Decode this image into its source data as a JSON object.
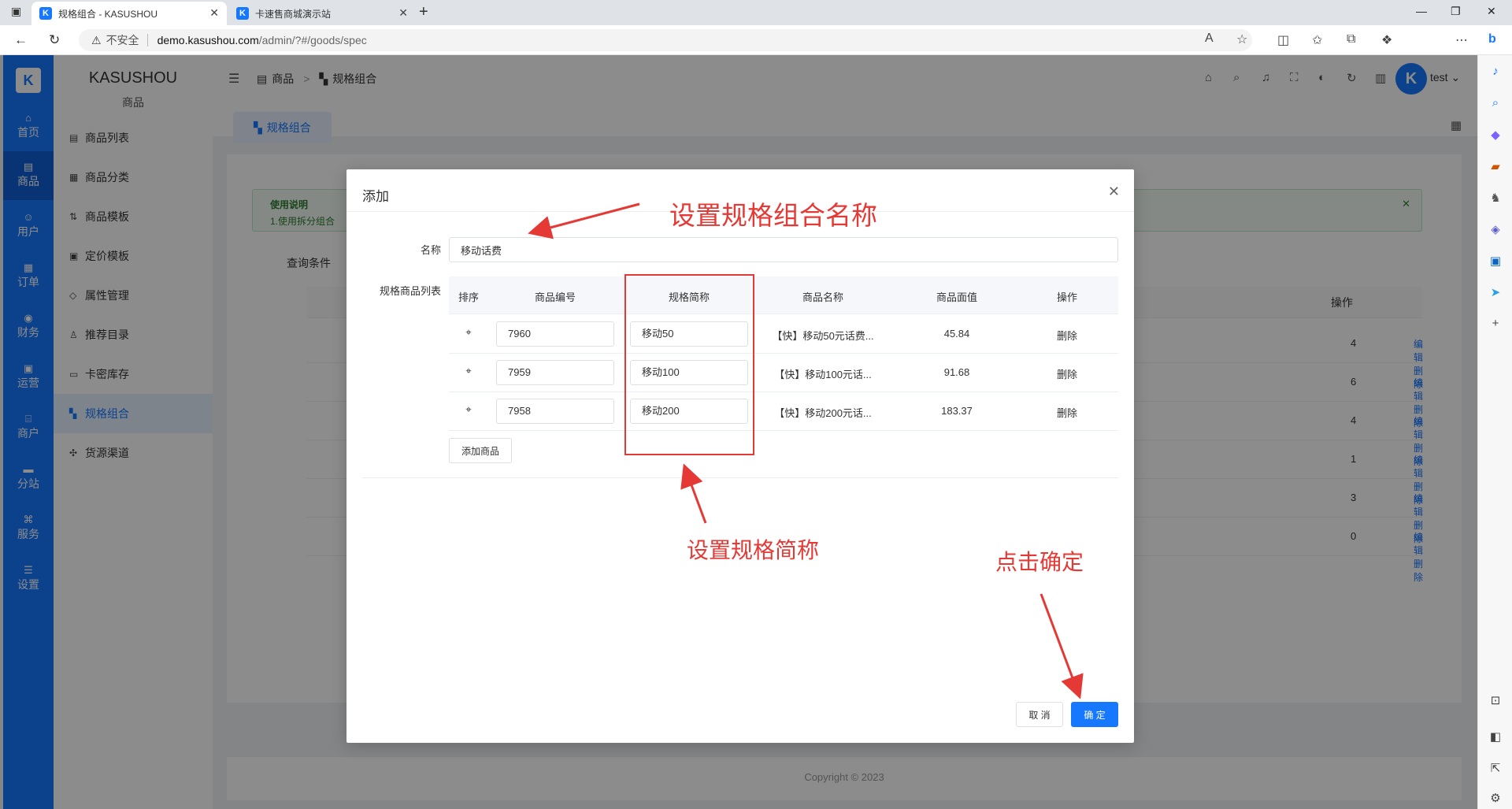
{
  "browser": {
    "tabs": [
      {
        "title": "规格组合 - KASUSHOU",
        "favicon": "K"
      },
      {
        "title": "卡速售商城演示站",
        "favicon": "K"
      }
    ],
    "address": {
      "warning_label": "不安全",
      "host": "demo.kasushou.com",
      "path": "/admin/?#/goods/spec"
    }
  },
  "rail": {
    "logo": "K",
    "items": [
      {
        "icon": "home-icon",
        "label": "首页"
      },
      {
        "icon": "goods-icon",
        "label": "商品"
      },
      {
        "icon": "user-icon",
        "label": "用户"
      },
      {
        "icon": "order-icon",
        "label": "订单"
      },
      {
        "icon": "finance-icon",
        "label": "财务"
      },
      {
        "icon": "operate-icon",
        "label": "运营"
      },
      {
        "icon": "merchant-icon",
        "label": "商户"
      },
      {
        "icon": "branch-icon",
        "label": "分站"
      },
      {
        "icon": "service-icon",
        "label": "服务"
      },
      {
        "icon": "settings-icon",
        "label": "设置"
      }
    ],
    "active_index": 1
  },
  "submenu": {
    "brand": "KASUSHOU",
    "section": "商品",
    "items": [
      {
        "icon": "list-icon",
        "label": "商品列表"
      },
      {
        "icon": "category-icon",
        "label": "商品分类"
      },
      {
        "icon": "template-icon",
        "label": "商品模板"
      },
      {
        "icon": "price-icon",
        "label": "定价模板"
      },
      {
        "icon": "tag-icon",
        "label": "属性管理"
      },
      {
        "icon": "thumb-icon",
        "label": "推荐目录"
      },
      {
        "icon": "card-icon",
        "label": "卡密库存"
      },
      {
        "icon": "spec-icon",
        "label": "规格组合"
      },
      {
        "icon": "source-icon",
        "label": "货源渠道"
      }
    ],
    "active_index": 7
  },
  "header": {
    "breadcrumb": [
      "商品",
      "规格组合"
    ],
    "breadcrumb_sep": ">",
    "user": "test",
    "avatar": "K"
  },
  "page_tab": "规格组合",
  "background": {
    "notice_title": "使用说明",
    "notice_text": "1.使用拆分组合",
    "query_label": "查询条件",
    "op_header": "操作",
    "rows": [
      {
        "num": "4",
        "edit": "编辑",
        "del": "删除"
      },
      {
        "num": "6",
        "edit": "编辑",
        "del": "删除"
      },
      {
        "num": "4",
        "edit": "编辑",
        "del": "删除"
      },
      {
        "num": "1",
        "edit": "编辑",
        "del": "删除"
      },
      {
        "num": "3",
        "edit": "编辑",
        "del": "删除"
      },
      {
        "num": "0",
        "edit": "编辑",
        "del": "删除"
      }
    ],
    "copyright": "Copyright © 2023"
  },
  "modal": {
    "title": "添加",
    "name_label": "名称",
    "name_value": "移动话费",
    "list_label": "规格商品列表",
    "columns": [
      "排序",
      "商品编号",
      "规格简称",
      "商品名称",
      "商品面值",
      "操作"
    ],
    "rows": [
      {
        "code": "7960",
        "short": "移动50",
        "name": "【快】移动50元话费...",
        "value": "45.84",
        "action": "删除"
      },
      {
        "code": "7959",
        "short": "移动100",
        "name": "【快】移动100元话...",
        "value": "91.68",
        "action": "删除"
      },
      {
        "code": "7958",
        "short": "移动200",
        "name": "【快】移动200元话...",
        "value": "183.37",
        "action": "删除"
      }
    ],
    "add_button": "添加商品",
    "cancel": "取 消",
    "confirm": "确 定"
  },
  "annotations": {
    "name_hint": "设置规格组合名称",
    "short_hint": "设置规格简称",
    "confirm_hint": "点击确定",
    "color": "#e53935"
  },
  "colors": {
    "primary": "#1677ff",
    "rail_active": "#0f5fd6"
  }
}
